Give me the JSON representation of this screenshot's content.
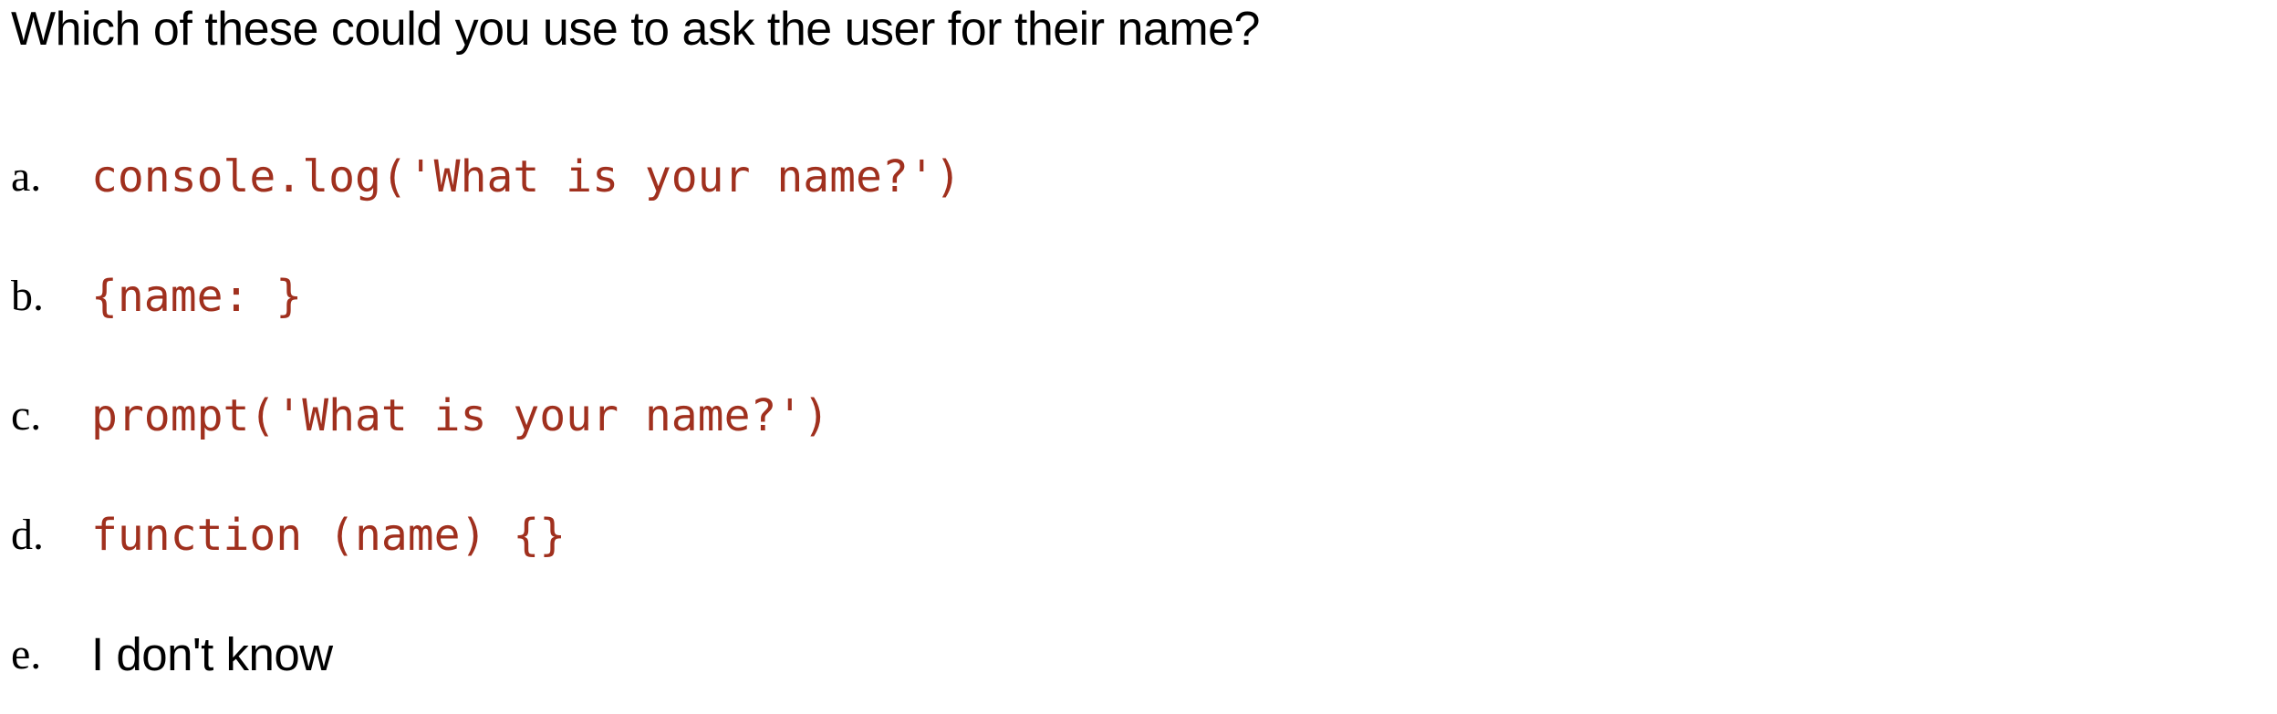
{
  "question": "Which of these could you use to ask the user for their name?",
  "options": [
    {
      "marker": "a.",
      "text": "console.log('What is your name?')"
    },
    {
      "marker": "b.",
      "text": "{name: }"
    },
    {
      "marker": "c.",
      "text": "prompt('What is your name?')"
    },
    {
      "marker": "d.",
      "text": "function (name) {}"
    },
    {
      "marker": "e.",
      "text": "I don't know"
    }
  ],
  "colors": {
    "code": "#a0301e",
    "text": "#000000",
    "background": "#ffffff"
  }
}
